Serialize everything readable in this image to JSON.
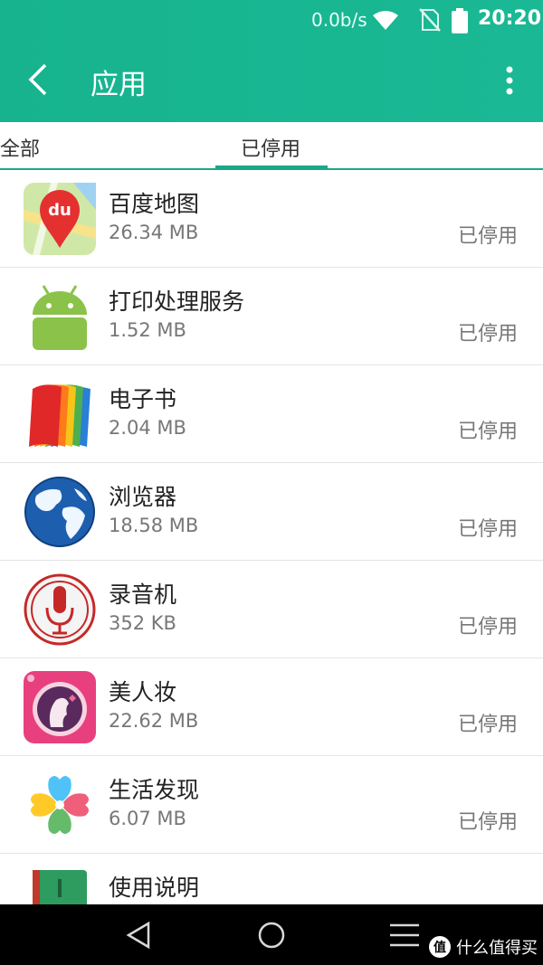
{
  "status_bar": {
    "speed": "0.0b/s",
    "time": "20:20"
  },
  "app_bar": {
    "title": "应用"
  },
  "tabs": [
    {
      "label": "全部"
    },
    {
      "label": "已停用"
    }
  ],
  "apps": [
    {
      "name": "百度地图",
      "size": "26.34 MB",
      "status": "已停用",
      "icon": "baidu-map-icon"
    },
    {
      "name": "打印处理服务",
      "size": "1.52 MB",
      "status": "已停用",
      "icon": "android-icon"
    },
    {
      "name": "电子书",
      "size": "2.04 MB",
      "status": "已停用",
      "icon": "ebook-icon"
    },
    {
      "name": "浏览器",
      "size": "18.58 MB",
      "status": "已停用",
      "icon": "globe-icon"
    },
    {
      "name": "录音机",
      "size": "352 KB",
      "status": "已停用",
      "icon": "microphone-icon"
    },
    {
      "name": "美人妆",
      "size": "22.62 MB",
      "status": "已停用",
      "icon": "beauty-icon"
    },
    {
      "name": "生活发现",
      "size": "6.07 MB",
      "status": "已停用",
      "icon": "clover-icon"
    },
    {
      "name": "使用说明",
      "size": "",
      "status": "",
      "icon": "manual-icon"
    }
  ],
  "watermark": {
    "badge": "值",
    "text": "什么值得买"
  },
  "colors": {
    "accent": "#1aa889",
    "appbar": "#17b38f"
  }
}
